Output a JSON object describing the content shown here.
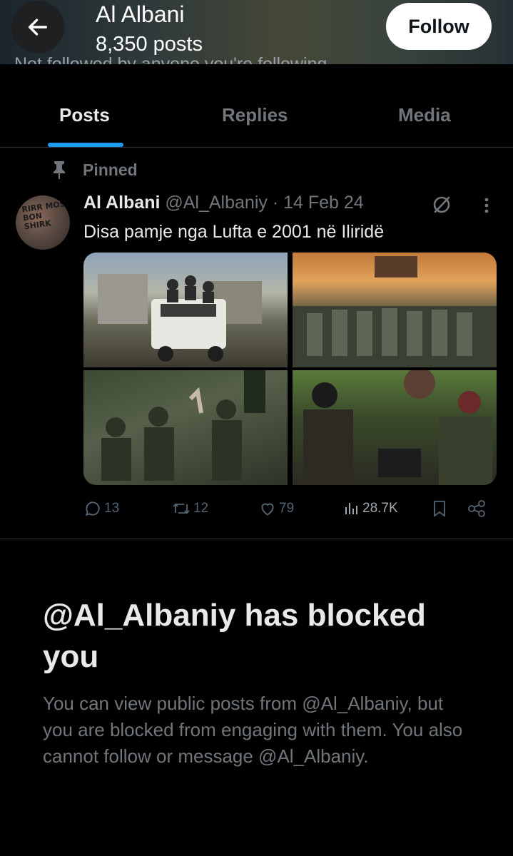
{
  "header": {
    "title": "Al Albani",
    "posts_count": "8,350 posts",
    "follow_label": "Follow",
    "ghost_text": "Not followed by anyone you're following"
  },
  "tabs": [
    {
      "label": "Posts",
      "active": true
    },
    {
      "label": "Replies",
      "active": false
    },
    {
      "label": "Media",
      "active": false
    }
  ],
  "pinned": {
    "label": "Pinned",
    "icon": "pin-icon"
  },
  "post": {
    "author_name": "Al Albani",
    "handle": "@Al_Albaniy",
    "separator": "·",
    "date": "14 Feb 24",
    "text": "Disa pamje nga Lufta e 2001 në Iliridë",
    "avatar_text": "RIRR MOS BON SHIRK",
    "media_count": 4,
    "metrics": {
      "replies": "13",
      "reposts": "12",
      "likes": "79",
      "views": "28.7K"
    }
  },
  "blocked": {
    "title": "@Al_Albaniy has blocked you",
    "body": "You can view public posts from @Al_Albaniy, but you are blocked from engaging with them. You also cannot follow or message @Al_Albaniy."
  },
  "colors": {
    "background": "#000000",
    "accent": "#1d9bf0",
    "text_primary": "#e7e9ea",
    "text_secondary": "#71767b",
    "border": "#2f3336"
  }
}
